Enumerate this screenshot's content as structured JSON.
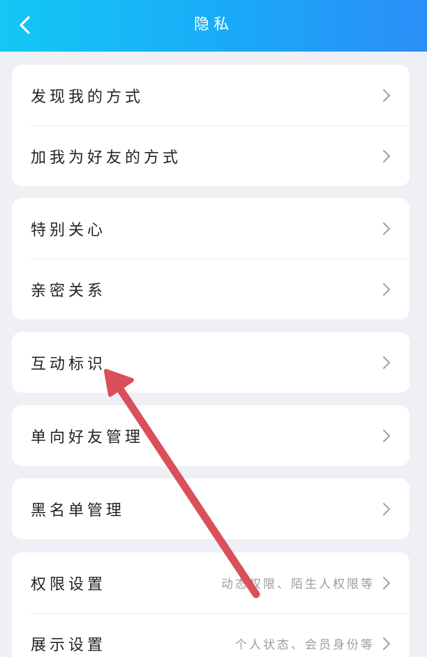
{
  "header": {
    "title": "隐私"
  },
  "groups": [
    [
      {
        "label": "发现我的方式"
      },
      {
        "label": "加我为好友的方式"
      }
    ],
    [
      {
        "label": "特别关心"
      },
      {
        "label": "亲密关系"
      }
    ],
    [
      {
        "label": "互动标识"
      }
    ],
    [
      {
        "label": "单向好友管理"
      }
    ],
    [
      {
        "label": "黑名单管理"
      }
    ],
    [
      {
        "label": "权限设置",
        "hint": "动态权限、陌生人权限等"
      },
      {
        "label": "展示设置",
        "hint": "个人状态、会员身份等"
      }
    ]
  ],
  "colors": {
    "header_start": "#14c8f5",
    "header_end": "#2b8ef7",
    "annotation_arrow": "#d9505b"
  },
  "icons": {
    "back": "chevron-left-icon",
    "row": "chevron-right-icon"
  }
}
